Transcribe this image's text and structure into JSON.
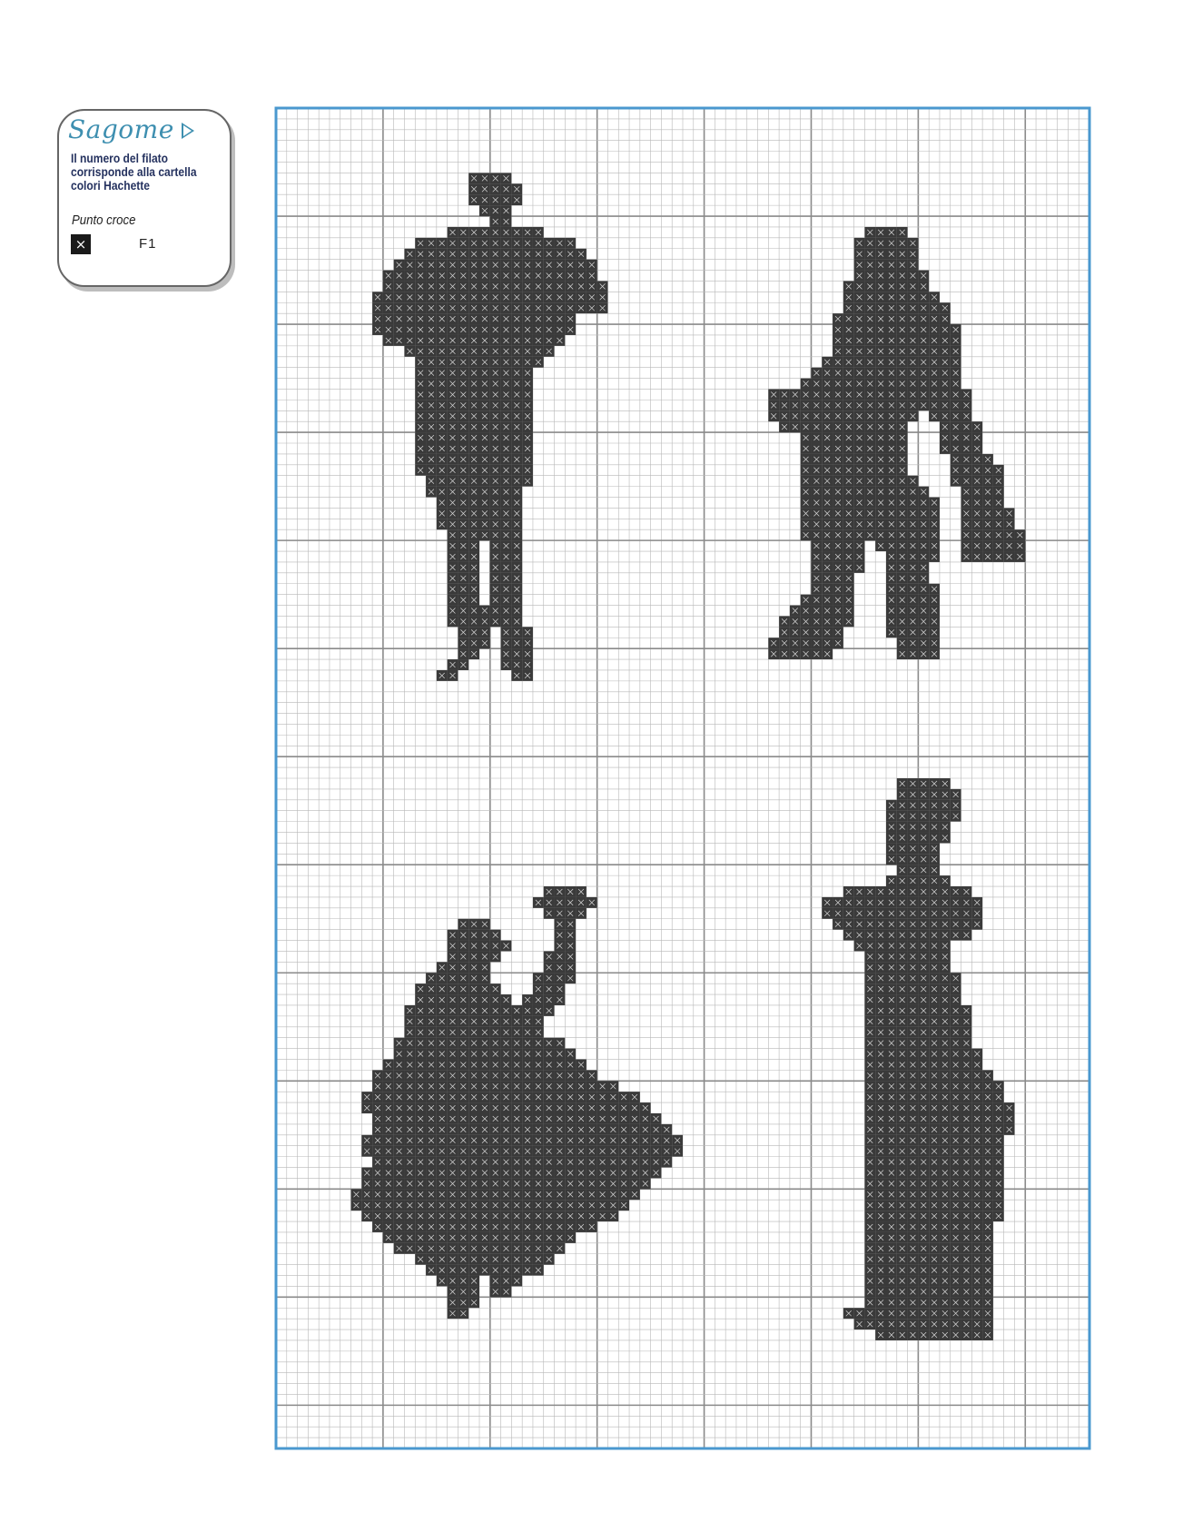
{
  "legend": {
    "title": "Sagome",
    "description": "Il numero del filato corrisponde alla cartella colori Hachette",
    "stitch_type": "Punto croce",
    "symbol": "×",
    "thread_code": "F1",
    "swatch_color": "#1a1a1a",
    "title_color": "#3e8fb0",
    "description_color": "#25325f"
  },
  "chart": {
    "grid_columns": 76,
    "grid_rows": 124,
    "major_every": 10,
    "border_color": "#4a98cf",
    "minor_line_color": "#b8b8b8",
    "major_line_color": "#8a8a8a",
    "stitch_color": "#3a3a3a",
    "motifs": [
      {
        "name": "man-with-accordion",
        "rows": [
          [
            6,
            18,
            21
          ],
          [
            7,
            18,
            22
          ],
          [
            8,
            18,
            22
          ],
          [
            9,
            19,
            21
          ],
          [
            10,
            20,
            21
          ],
          [
            11,
            16,
            24
          ],
          [
            12,
            13,
            27
          ],
          [
            13,
            12,
            28
          ],
          [
            14,
            11,
            29
          ],
          [
            15,
            10,
            29
          ],
          [
            16,
            10,
            30
          ],
          [
            17,
            9,
            30
          ],
          [
            18,
            9,
            30
          ],
          [
            19,
            9,
            27
          ],
          [
            20,
            9,
            27
          ],
          [
            21,
            10,
            26
          ],
          [
            22,
            12,
            25
          ],
          [
            23,
            13,
            24
          ],
          [
            24,
            13,
            23
          ],
          [
            25,
            13,
            23
          ],
          [
            26,
            13,
            23
          ],
          [
            27,
            13,
            23
          ],
          [
            28,
            13,
            23
          ],
          [
            29,
            13,
            23
          ],
          [
            30,
            13,
            23
          ],
          [
            31,
            13,
            23
          ],
          [
            32,
            13,
            23
          ],
          [
            33,
            13,
            23
          ],
          [
            34,
            14,
            23
          ],
          [
            35,
            14,
            22
          ],
          [
            36,
            15,
            22
          ],
          [
            37,
            15,
            22
          ],
          [
            38,
            15,
            22
          ],
          [
            39,
            16,
            22
          ],
          [
            40,
            16,
            18
          ],
          [
            40,
            20,
            22
          ],
          [
            41,
            16,
            18
          ],
          [
            41,
            20,
            22
          ],
          [
            42,
            16,
            18
          ],
          [
            42,
            20,
            22
          ],
          [
            43,
            16,
            18
          ],
          [
            43,
            20,
            22
          ],
          [
            44,
            16,
            18
          ],
          [
            44,
            20,
            22
          ],
          [
            45,
            16,
            18
          ],
          [
            45,
            20,
            22
          ],
          [
            46,
            16,
            19
          ],
          [
            46,
            20,
            22
          ],
          [
            47,
            16,
            19
          ],
          [
            47,
            20,
            22
          ],
          [
            48,
            17,
            19
          ],
          [
            48,
            21,
            23
          ],
          [
            49,
            17,
            19
          ],
          [
            49,
            21,
            23
          ],
          [
            50,
            17,
            18
          ],
          [
            50,
            21,
            23
          ],
          [
            51,
            16,
            17
          ],
          [
            51,
            21,
            23
          ],
          [
            52,
            15,
            16
          ],
          [
            52,
            22,
            23
          ]
        ]
      },
      {
        "name": "man-with-basket",
        "rows": [
          [
            11,
            55,
            58
          ],
          [
            12,
            54,
            59
          ],
          [
            13,
            54,
            59
          ],
          [
            14,
            54,
            59
          ],
          [
            15,
            54,
            60
          ],
          [
            16,
            53,
            60
          ],
          [
            17,
            53,
            61
          ],
          [
            18,
            53,
            62
          ],
          [
            19,
            52,
            62
          ],
          [
            20,
            52,
            63
          ],
          [
            21,
            52,
            63
          ],
          [
            22,
            52,
            63
          ],
          [
            23,
            51,
            63
          ],
          [
            24,
            50,
            63
          ],
          [
            25,
            49,
            63
          ],
          [
            26,
            46,
            64
          ],
          [
            27,
            46,
            64
          ],
          [
            28,
            46,
            59
          ],
          [
            28,
            61,
            64
          ],
          [
            29,
            47,
            58
          ],
          [
            29,
            62,
            65
          ],
          [
            30,
            49,
            58
          ],
          [
            30,
            62,
            65
          ],
          [
            31,
            49,
            58
          ],
          [
            31,
            62,
            65
          ],
          [
            32,
            49,
            58
          ],
          [
            32,
            63,
            66
          ],
          [
            33,
            49,
            58
          ],
          [
            33,
            63,
            67
          ],
          [
            34,
            49,
            59
          ],
          [
            34,
            63,
            67
          ],
          [
            35,
            49,
            60
          ],
          [
            35,
            64,
            67
          ],
          [
            36,
            49,
            61
          ],
          [
            36,
            64,
            67
          ],
          [
            37,
            49,
            61
          ],
          [
            37,
            64,
            68
          ],
          [
            38,
            49,
            61
          ],
          [
            38,
            64,
            68
          ],
          [
            39,
            49,
            61
          ],
          [
            39,
            64,
            69
          ],
          [
            40,
            50,
            54
          ],
          [
            40,
            56,
            61
          ],
          [
            40,
            64,
            69
          ],
          [
            41,
            50,
            54
          ],
          [
            41,
            57,
            61
          ],
          [
            41,
            64,
            69
          ],
          [
            42,
            50,
            54
          ],
          [
            42,
            57,
            60
          ],
          [
            43,
            50,
            53
          ],
          [
            43,
            57,
            60
          ],
          [
            44,
            50,
            53
          ],
          [
            44,
            57,
            61
          ],
          [
            45,
            49,
            53
          ],
          [
            45,
            57,
            61
          ],
          [
            46,
            48,
            53
          ],
          [
            46,
            57,
            61
          ],
          [
            47,
            47,
            53
          ],
          [
            47,
            57,
            61
          ],
          [
            48,
            47,
            52
          ],
          [
            48,
            57,
            61
          ],
          [
            49,
            46,
            52
          ],
          [
            49,
            58,
            61
          ],
          [
            50,
            46,
            51
          ],
          [
            50,
            58,
            61
          ]
        ]
      },
      {
        "name": "woman-with-flower",
        "rows": [
          [
            72,
            25,
            28
          ],
          [
            73,
            24,
            29
          ],
          [
            74,
            25,
            28
          ],
          [
            75,
            26,
            27
          ],
          [
            75,
            17,
            19
          ],
          [
            76,
            16,
            20
          ],
          [
            76,
            26,
            27
          ],
          [
            77,
            16,
            21
          ],
          [
            77,
            26,
            27
          ],
          [
            78,
            16,
            20
          ],
          [
            78,
            25,
            27
          ],
          [
            79,
            15,
            19
          ],
          [
            79,
            25,
            27
          ],
          [
            80,
            14,
            19
          ],
          [
            80,
            24,
            27
          ],
          [
            81,
            13,
            20
          ],
          [
            81,
            24,
            26
          ],
          [
            82,
            13,
            21
          ],
          [
            82,
            23,
            26
          ],
          [
            83,
            12,
            22
          ],
          [
            83,
            22,
            25
          ],
          [
            84,
            12,
            24
          ],
          [
            85,
            12,
            24
          ],
          [
            86,
            11,
            26
          ],
          [
            87,
            11,
            27
          ],
          [
            88,
            10,
            28
          ],
          [
            89,
            9,
            29
          ],
          [
            90,
            9,
            31
          ],
          [
            91,
            8,
            33
          ],
          [
            92,
            8,
            34
          ],
          [
            93,
            9,
            35
          ],
          [
            94,
            9,
            36
          ],
          [
            95,
            8,
            37
          ],
          [
            96,
            8,
            37
          ],
          [
            97,
            9,
            36
          ],
          [
            98,
            8,
            35
          ],
          [
            99,
            8,
            34
          ],
          [
            100,
            7,
            33
          ],
          [
            101,
            7,
            32
          ],
          [
            102,
            8,
            31
          ],
          [
            103,
            9,
            29
          ],
          [
            104,
            10,
            27
          ],
          [
            105,
            11,
            26
          ],
          [
            106,
            13,
            25
          ],
          [
            107,
            14,
            24
          ],
          [
            108,
            15,
            18
          ],
          [
            108,
            20,
            22
          ],
          [
            109,
            16,
            18
          ],
          [
            109,
            20,
            21
          ],
          [
            110,
            16,
            18
          ],
          [
            111,
            16,
            17
          ]
        ]
      },
      {
        "name": "woman-with-parasol",
        "rows": [
          [
            62,
            58,
            62
          ],
          [
            63,
            58,
            63
          ],
          [
            64,
            57,
            63
          ],
          [
            65,
            57,
            63
          ],
          [
            66,
            57,
            62
          ],
          [
            67,
            57,
            62
          ],
          [
            68,
            57,
            61
          ],
          [
            69,
            57,
            61
          ],
          [
            70,
            58,
            61
          ],
          [
            71,
            57,
            62
          ],
          [
            72,
            53,
            64
          ],
          [
            73,
            51,
            65
          ],
          [
            74,
            51,
            65
          ],
          [
            75,
            52,
            65
          ],
          [
            76,
            53,
            64
          ],
          [
            77,
            54,
            62
          ],
          [
            78,
            55,
            62
          ],
          [
            79,
            55,
            62
          ],
          [
            80,
            55,
            63
          ],
          [
            81,
            55,
            63
          ],
          [
            82,
            55,
            63
          ],
          [
            83,
            55,
            64
          ],
          [
            84,
            55,
            64
          ],
          [
            85,
            55,
            64
          ],
          [
            86,
            55,
            64
          ],
          [
            87,
            55,
            65
          ],
          [
            88,
            55,
            65
          ],
          [
            89,
            55,
            66
          ],
          [
            90,
            55,
            67
          ],
          [
            91,
            55,
            67
          ],
          [
            92,
            55,
            68
          ],
          [
            93,
            55,
            68
          ],
          [
            94,
            55,
            68
          ],
          [
            95,
            55,
            67
          ],
          [
            96,
            55,
            67
          ],
          [
            97,
            55,
            67
          ],
          [
            98,
            55,
            67
          ],
          [
            99,
            55,
            67
          ],
          [
            100,
            55,
            67
          ],
          [
            101,
            55,
            67
          ],
          [
            102,
            55,
            67
          ],
          [
            103,
            55,
            66
          ],
          [
            104,
            55,
            66
          ],
          [
            105,
            55,
            66
          ],
          [
            106,
            55,
            66
          ],
          [
            107,
            55,
            66
          ],
          [
            108,
            55,
            66
          ],
          [
            109,
            55,
            66
          ],
          [
            110,
            55,
            66
          ],
          [
            111,
            53,
            66
          ],
          [
            112,
            54,
            66
          ],
          [
            113,
            56,
            66
          ]
        ]
      }
    ]
  }
}
